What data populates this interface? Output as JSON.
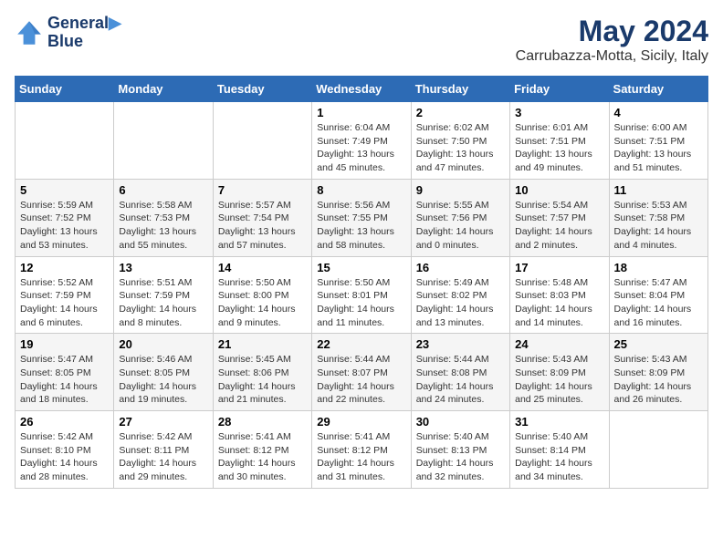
{
  "logo": {
    "line1": "General",
    "line2": "Blue"
  },
  "title": "May 2024",
  "subtitle": "Carrubazza-Motta, Sicily, Italy",
  "days_of_week": [
    "Sunday",
    "Monday",
    "Tuesday",
    "Wednesday",
    "Thursday",
    "Friday",
    "Saturday"
  ],
  "weeks": [
    [
      {
        "day": "",
        "info": ""
      },
      {
        "day": "",
        "info": ""
      },
      {
        "day": "",
        "info": ""
      },
      {
        "day": "1",
        "info": "Sunrise: 6:04 AM\nSunset: 7:49 PM\nDaylight: 13 hours\nand 45 minutes."
      },
      {
        "day": "2",
        "info": "Sunrise: 6:02 AM\nSunset: 7:50 PM\nDaylight: 13 hours\nand 47 minutes."
      },
      {
        "day": "3",
        "info": "Sunrise: 6:01 AM\nSunset: 7:51 PM\nDaylight: 13 hours\nand 49 minutes."
      },
      {
        "day": "4",
        "info": "Sunrise: 6:00 AM\nSunset: 7:51 PM\nDaylight: 13 hours\nand 51 minutes."
      }
    ],
    [
      {
        "day": "5",
        "info": "Sunrise: 5:59 AM\nSunset: 7:52 PM\nDaylight: 13 hours\nand 53 minutes."
      },
      {
        "day": "6",
        "info": "Sunrise: 5:58 AM\nSunset: 7:53 PM\nDaylight: 13 hours\nand 55 minutes."
      },
      {
        "day": "7",
        "info": "Sunrise: 5:57 AM\nSunset: 7:54 PM\nDaylight: 13 hours\nand 57 minutes."
      },
      {
        "day": "8",
        "info": "Sunrise: 5:56 AM\nSunset: 7:55 PM\nDaylight: 13 hours\nand 58 minutes."
      },
      {
        "day": "9",
        "info": "Sunrise: 5:55 AM\nSunset: 7:56 PM\nDaylight: 14 hours\nand 0 minutes."
      },
      {
        "day": "10",
        "info": "Sunrise: 5:54 AM\nSunset: 7:57 PM\nDaylight: 14 hours\nand 2 minutes."
      },
      {
        "day": "11",
        "info": "Sunrise: 5:53 AM\nSunset: 7:58 PM\nDaylight: 14 hours\nand 4 minutes."
      }
    ],
    [
      {
        "day": "12",
        "info": "Sunrise: 5:52 AM\nSunset: 7:59 PM\nDaylight: 14 hours\nand 6 minutes."
      },
      {
        "day": "13",
        "info": "Sunrise: 5:51 AM\nSunset: 7:59 PM\nDaylight: 14 hours\nand 8 minutes."
      },
      {
        "day": "14",
        "info": "Sunrise: 5:50 AM\nSunset: 8:00 PM\nDaylight: 14 hours\nand 9 minutes."
      },
      {
        "day": "15",
        "info": "Sunrise: 5:50 AM\nSunset: 8:01 PM\nDaylight: 14 hours\nand 11 minutes."
      },
      {
        "day": "16",
        "info": "Sunrise: 5:49 AM\nSunset: 8:02 PM\nDaylight: 14 hours\nand 13 minutes."
      },
      {
        "day": "17",
        "info": "Sunrise: 5:48 AM\nSunset: 8:03 PM\nDaylight: 14 hours\nand 14 minutes."
      },
      {
        "day": "18",
        "info": "Sunrise: 5:47 AM\nSunset: 8:04 PM\nDaylight: 14 hours\nand 16 minutes."
      }
    ],
    [
      {
        "day": "19",
        "info": "Sunrise: 5:47 AM\nSunset: 8:05 PM\nDaylight: 14 hours\nand 18 minutes."
      },
      {
        "day": "20",
        "info": "Sunrise: 5:46 AM\nSunset: 8:05 PM\nDaylight: 14 hours\nand 19 minutes."
      },
      {
        "day": "21",
        "info": "Sunrise: 5:45 AM\nSunset: 8:06 PM\nDaylight: 14 hours\nand 21 minutes."
      },
      {
        "day": "22",
        "info": "Sunrise: 5:44 AM\nSunset: 8:07 PM\nDaylight: 14 hours\nand 22 minutes."
      },
      {
        "day": "23",
        "info": "Sunrise: 5:44 AM\nSunset: 8:08 PM\nDaylight: 14 hours\nand 24 minutes."
      },
      {
        "day": "24",
        "info": "Sunrise: 5:43 AM\nSunset: 8:09 PM\nDaylight: 14 hours\nand 25 minutes."
      },
      {
        "day": "25",
        "info": "Sunrise: 5:43 AM\nSunset: 8:09 PM\nDaylight: 14 hours\nand 26 minutes."
      }
    ],
    [
      {
        "day": "26",
        "info": "Sunrise: 5:42 AM\nSunset: 8:10 PM\nDaylight: 14 hours\nand 28 minutes."
      },
      {
        "day": "27",
        "info": "Sunrise: 5:42 AM\nSunset: 8:11 PM\nDaylight: 14 hours\nand 29 minutes."
      },
      {
        "day": "28",
        "info": "Sunrise: 5:41 AM\nSunset: 8:12 PM\nDaylight: 14 hours\nand 30 minutes."
      },
      {
        "day": "29",
        "info": "Sunrise: 5:41 AM\nSunset: 8:12 PM\nDaylight: 14 hours\nand 31 minutes."
      },
      {
        "day": "30",
        "info": "Sunrise: 5:40 AM\nSunset: 8:13 PM\nDaylight: 14 hours\nand 32 minutes."
      },
      {
        "day": "31",
        "info": "Sunrise: 5:40 AM\nSunset: 8:14 PM\nDaylight: 14 hours\nand 34 minutes."
      },
      {
        "day": "",
        "info": ""
      }
    ]
  ]
}
